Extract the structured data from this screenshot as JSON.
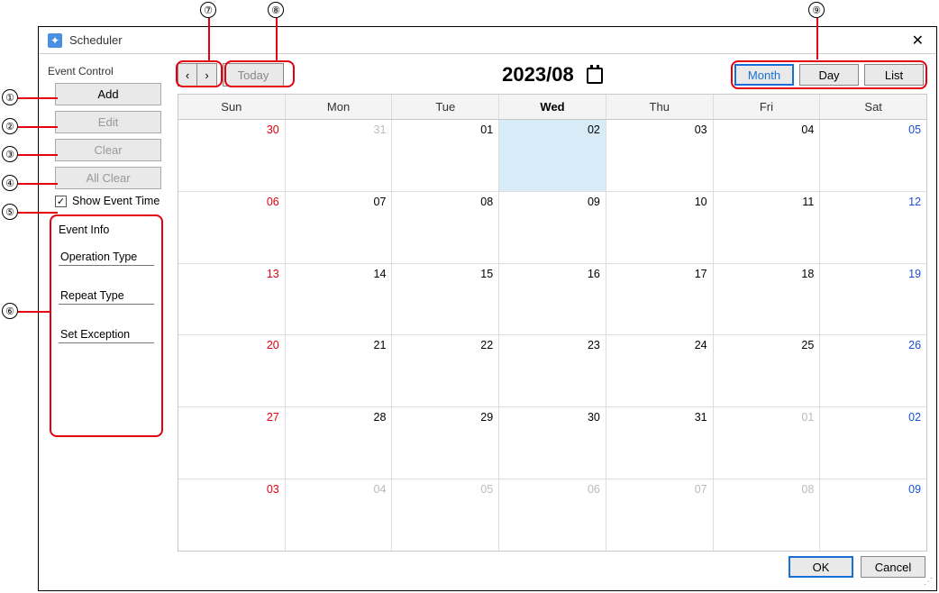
{
  "window": {
    "title": "Scheduler"
  },
  "sidebar": {
    "group_label": "Event Control",
    "add": "Add",
    "edit": "Edit",
    "clear": "Clear",
    "all_clear": "All Clear",
    "show_event_time": "Show Event Time",
    "show_event_time_checked": true
  },
  "event_info": {
    "title": "Event Info",
    "operation_type": "Operation Type",
    "repeat_type": "Repeat Type",
    "set_exception": "Set Exception"
  },
  "toolbar": {
    "today": "Today",
    "period": "2023/08",
    "views": {
      "month": "Month",
      "day": "Day",
      "list": "List"
    },
    "active_view": "month"
  },
  "calendar": {
    "headers": [
      "Sun",
      "Mon",
      "Tue",
      "Wed",
      "Thu",
      "Fri",
      "Sat"
    ],
    "today_col": 3,
    "weeks": [
      [
        {
          "n": "30",
          "cls": "sun"
        },
        {
          "n": "31",
          "cls": "out"
        },
        {
          "n": "01",
          "cls": ""
        },
        {
          "n": "02",
          "cls": "today-cell"
        },
        {
          "n": "03",
          "cls": ""
        },
        {
          "n": "04",
          "cls": ""
        },
        {
          "n": "05",
          "cls": "sat"
        }
      ],
      [
        {
          "n": "06",
          "cls": "sun"
        },
        {
          "n": "07",
          "cls": ""
        },
        {
          "n": "08",
          "cls": ""
        },
        {
          "n": "09",
          "cls": ""
        },
        {
          "n": "10",
          "cls": ""
        },
        {
          "n": "11",
          "cls": ""
        },
        {
          "n": "12",
          "cls": "sat"
        }
      ],
      [
        {
          "n": "13",
          "cls": "sun"
        },
        {
          "n": "14",
          "cls": ""
        },
        {
          "n": "15",
          "cls": ""
        },
        {
          "n": "16",
          "cls": ""
        },
        {
          "n": "17",
          "cls": ""
        },
        {
          "n": "18",
          "cls": ""
        },
        {
          "n": "19",
          "cls": "sat"
        }
      ],
      [
        {
          "n": "20",
          "cls": "sun"
        },
        {
          "n": "21",
          "cls": ""
        },
        {
          "n": "22",
          "cls": ""
        },
        {
          "n": "23",
          "cls": ""
        },
        {
          "n": "24",
          "cls": ""
        },
        {
          "n": "25",
          "cls": ""
        },
        {
          "n": "26",
          "cls": "sat"
        }
      ],
      [
        {
          "n": "27",
          "cls": "sun"
        },
        {
          "n": "28",
          "cls": ""
        },
        {
          "n": "29",
          "cls": ""
        },
        {
          "n": "30",
          "cls": ""
        },
        {
          "n": "31",
          "cls": ""
        },
        {
          "n": "01",
          "cls": "out"
        },
        {
          "n": "02",
          "cls": "sat"
        }
      ],
      [
        {
          "n": "03",
          "cls": "sun"
        },
        {
          "n": "04",
          "cls": "out"
        },
        {
          "n": "05",
          "cls": "out"
        },
        {
          "n": "06",
          "cls": "out"
        },
        {
          "n": "07",
          "cls": "out"
        },
        {
          "n": "08",
          "cls": "out"
        },
        {
          "n": "09",
          "cls": "sat"
        }
      ]
    ]
  },
  "footer": {
    "ok": "OK",
    "cancel": "Cancel"
  },
  "callouts": {
    "c1": "①",
    "c2": "②",
    "c3": "③",
    "c4": "④",
    "c5": "⑤",
    "c6": "⑥",
    "c7": "⑦",
    "c8": "⑧",
    "c9": "⑨"
  }
}
